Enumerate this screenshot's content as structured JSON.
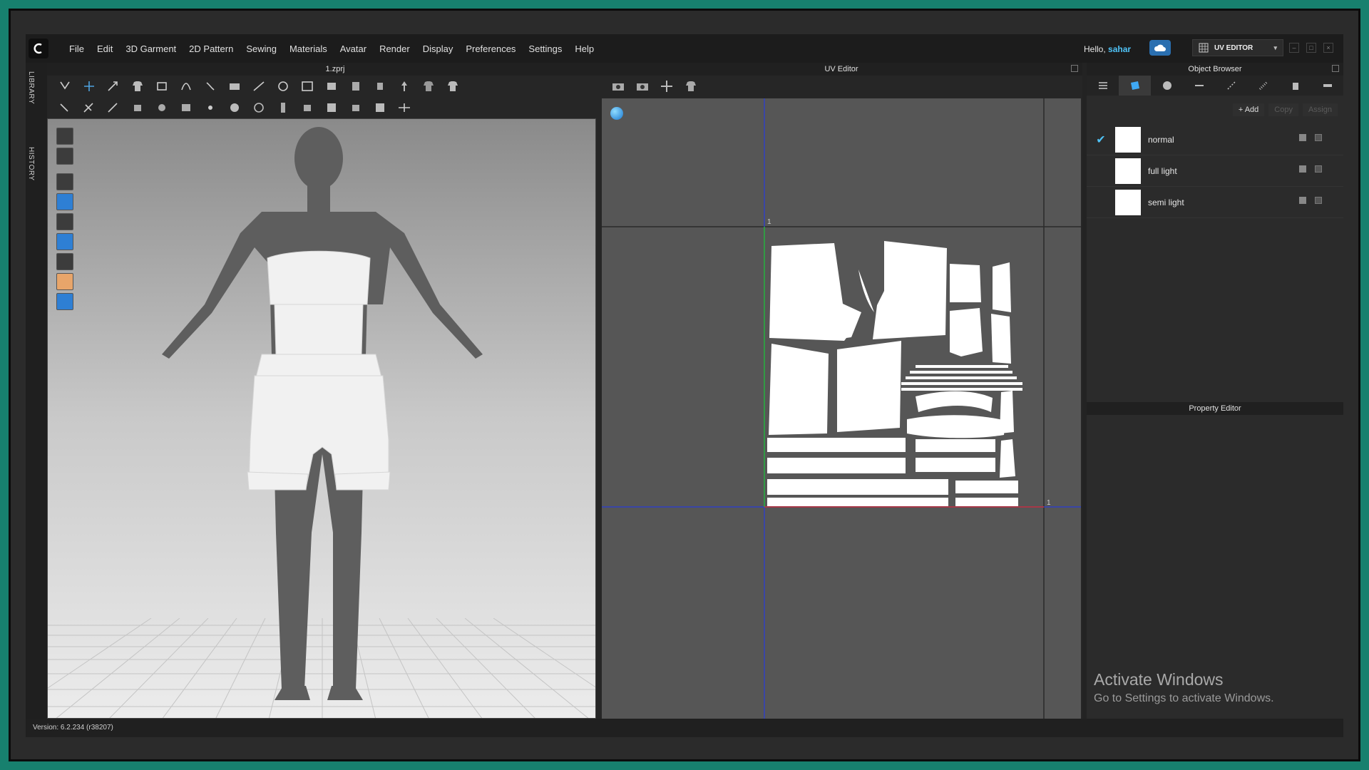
{
  "app": {
    "menu": [
      "File",
      "Edit",
      "3D Garment",
      "2D Pattern",
      "Sewing",
      "Materials",
      "Avatar",
      "Render",
      "Display",
      "Preferences",
      "Settings",
      "Help"
    ],
    "greeting_prefix": "Hello,",
    "user_name": "sahar",
    "mode_label": "UV EDITOR",
    "accent_color": "#4fc3f7"
  },
  "side_tabs": {
    "library": "LIBRARY",
    "history": "HISTORY"
  },
  "viewport": {
    "title": "1.zprj"
  },
  "uv_editor": {
    "title": "UV Editor",
    "axis_label_top": "1",
    "axis_label_right": "1"
  },
  "object_browser": {
    "title": "Object Browser",
    "add_label": "+ Add",
    "copy_label": "Copy",
    "assign_label": "Assign",
    "items": [
      {
        "name": "normal",
        "checked": true
      },
      {
        "name": "full light",
        "checked": false
      },
      {
        "name": "semi light",
        "checked": false
      }
    ]
  },
  "property_editor": {
    "title": "Property Editor"
  },
  "watermark": {
    "title": "Activate Windows",
    "subtitle": "Go to Settings to activate Windows."
  },
  "status": {
    "version": "Version: 6.2.234 (r38207)"
  }
}
